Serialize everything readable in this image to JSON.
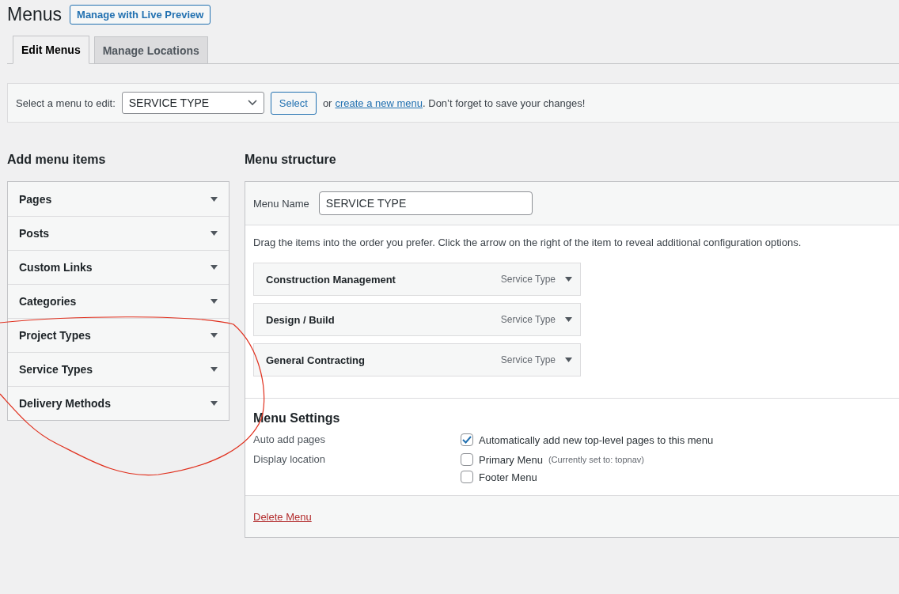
{
  "page": {
    "title": "Menus",
    "action_button": "Manage with Live Preview"
  },
  "tabs": [
    {
      "label": "Edit Menus",
      "selected": true
    },
    {
      "label": "Manage Locations",
      "selected": false
    }
  ],
  "menu_select_bar": {
    "label": "Select a menu to edit:",
    "value": "SERVICE TYPE",
    "button": "Select",
    "before_link": "or",
    "link": "create a new menu",
    "after_link": ". Don’t forget to save your changes!"
  },
  "add_menu_items": {
    "title": "Add menu items",
    "sections": [
      {
        "label": "Pages"
      },
      {
        "label": "Posts"
      },
      {
        "label": "Custom Links"
      },
      {
        "label": "Categories"
      },
      {
        "label": "Project Types"
      },
      {
        "label": "Service Types"
      },
      {
        "label": "Delivery Methods"
      }
    ]
  },
  "menu_structure": {
    "title": "Menu structure",
    "name_label": "Menu Name",
    "name_value": "SERVICE TYPE",
    "instructions": "Drag the items into the order you prefer. Click the arrow on the right of the item to reveal additional configuration options.",
    "items": [
      {
        "title": "Construction Management",
        "type": "Service Type"
      },
      {
        "title": "Design / Build",
        "type": "Service Type"
      },
      {
        "title": "General Contracting",
        "type": "Service Type"
      }
    ],
    "settings": {
      "title": "Menu Settings",
      "rows": [
        {
          "label": "Auto add pages",
          "options": [
            {
              "label": "Automatically add new top-level pages to this menu",
              "checked": true
            }
          ]
        },
        {
          "label": "Display location",
          "options": [
            {
              "label": "Primary Menu",
              "note": "(Currently set to: topnav)",
              "checked": false
            },
            {
              "label": "Footer Menu",
              "checked": false
            }
          ]
        }
      ]
    },
    "delete_link": "Delete Menu"
  }
}
